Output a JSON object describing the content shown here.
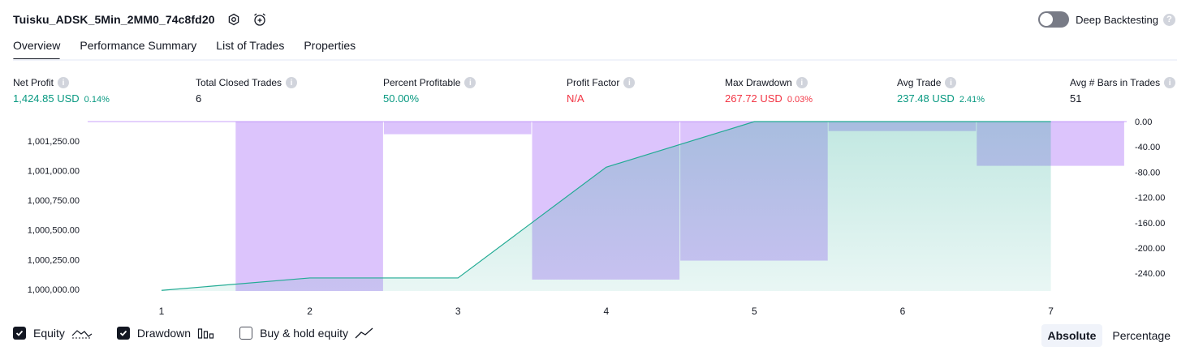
{
  "header": {
    "title": "Tuisku_ADSK_5Min_2MM0_74c8fd20",
    "settings_icon": "gear-icon",
    "alert_icon": "alarm-clock-plus-icon",
    "deep_backtesting_label": "Deep Backtesting",
    "deep_backtesting_on": false,
    "help_icon": "question-icon"
  },
  "tabs": [
    {
      "label": "Overview",
      "active": true
    },
    {
      "label": "Performance Summary",
      "active": false
    },
    {
      "label": "List of Trades",
      "active": false
    },
    {
      "label": "Properties",
      "active": false
    }
  ],
  "metrics": [
    {
      "label": "Net Profit",
      "value": "1,424.85 USD",
      "pct": "0.14%",
      "color": "green"
    },
    {
      "label": "Total Closed Trades",
      "value": "6",
      "pct": "",
      "color": "dark"
    },
    {
      "label": "Percent Profitable",
      "value": "50.00%",
      "pct": "",
      "color": "green"
    },
    {
      "label": "Profit Factor",
      "value": "N/A",
      "pct": "",
      "color": "red"
    },
    {
      "label": "Max Drawdown",
      "value": "267.72 USD",
      "pct": "0.03%",
      "color": "red"
    },
    {
      "label": "Avg Trade",
      "value": "237.48 USD",
      "pct": "2.41%",
      "color": "green"
    },
    {
      "label": "Avg # Bars in Trades",
      "value": "51",
      "pct": "",
      "color": "dark"
    }
  ],
  "chart_data": {
    "type": "line",
    "x": [
      1,
      2,
      3,
      4,
      5,
      6,
      7
    ],
    "series": [
      {
        "name": "Equity",
        "type": "area",
        "axis": "left",
        "values": [
          999990,
          1000095,
          1000095,
          1001030,
          1001415,
          1001415,
          1001415
        ]
      },
      {
        "name": "Drawdown",
        "type": "bar",
        "axis": "right",
        "values": [
          -268,
          -20,
          -250,
          -220,
          -15,
          -70
        ]
      }
    ],
    "drawdown_bar_positions": [
      2,
      3,
      4,
      5,
      6,
      7
    ],
    "left_axis": {
      "ticks": [
        "1,001,250.00",
        "1,001,000.00",
        "1,000,750.00",
        "1,000,500.00",
        "1,000,250.00",
        "1,000,000.00"
      ],
      "tick_values": [
        1001250,
        1001000,
        1000750,
        1000500,
        1000250,
        1000000
      ],
      "range": [
        999985,
        1001415
      ]
    },
    "right_axis": {
      "ticks": [
        "0.00",
        "-40.00",
        "-80.00",
        "-120.00",
        "-160.00",
        "-200.00",
        "-240.00"
      ],
      "tick_values": [
        0,
        -40,
        -80,
        -120,
        -160,
        -200,
        -240
      ],
      "range": [
        -268,
        0
      ]
    },
    "x_ticks": [
      "1",
      "2",
      "3",
      "4",
      "5",
      "6",
      "7"
    ],
    "grid": false,
    "colors": {
      "equity_line": "#22ab94",
      "equity_fill": "#22ab94",
      "drawdown": "#b27cf8"
    }
  },
  "legend": [
    {
      "label": "Equity",
      "checked": true,
      "icon": "equity-line-icon"
    },
    {
      "label": "Drawdown",
      "checked": true,
      "icon": "bars-icon"
    },
    {
      "label": "Buy & hold equity",
      "checked": false,
      "icon": "trend-line-icon"
    }
  ],
  "scale_toggle": {
    "absolute": "Absolute",
    "percentage": "Percentage",
    "selected": "Absolute"
  }
}
